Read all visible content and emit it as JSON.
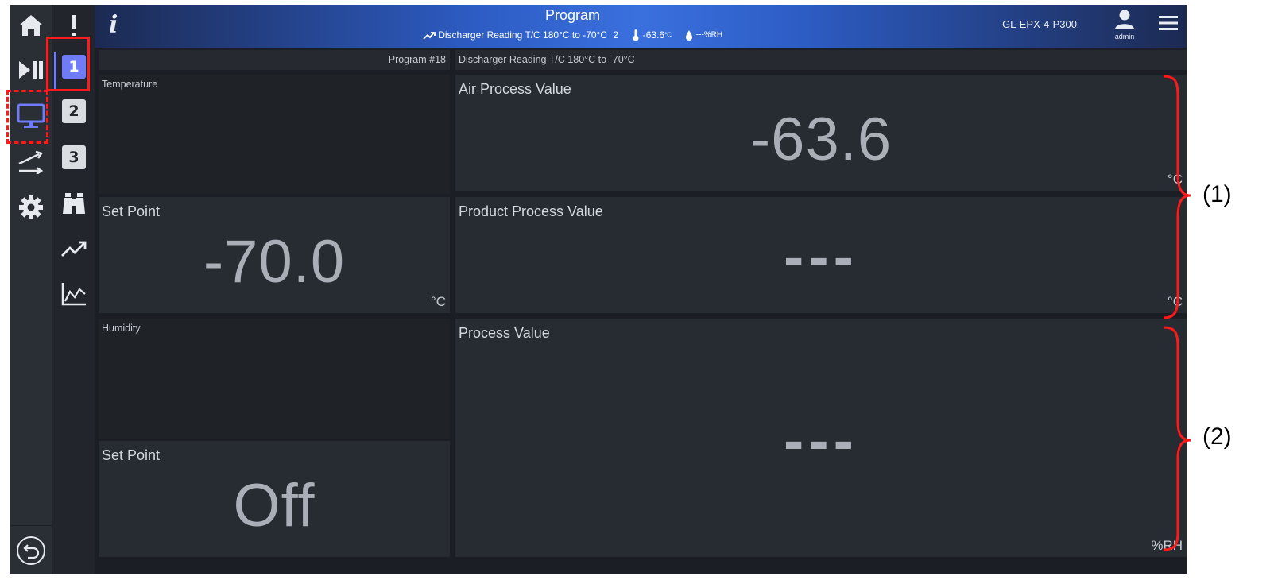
{
  "header": {
    "title": "Program",
    "subtitle_program": "Discharger Reading T/C 180°C to -70°C",
    "subtitle_step": "2",
    "subtitle_temp": "-63.6",
    "subtitle_temp_unit": "°C",
    "subtitle_humidity": "---%RH",
    "device_name": "GL-EPX-4-P300",
    "user_name": "admin"
  },
  "rail_primary": {
    "items": [
      "home-icon",
      "play-pause-icon",
      "monitor-icon",
      "transfer-icon",
      "gear-icon"
    ],
    "bottom": "back-icon"
  },
  "rail_secondary": {
    "items": [
      "alert-icon",
      "1",
      "2",
      "3",
      "binoculars-icon",
      "trend-icon",
      "chart-icon"
    ],
    "active": "1"
  },
  "program_bar": {
    "program_number": "Program #18",
    "program_name": "Discharger Reading T/C 180°C to -70°C"
  },
  "temperature": {
    "section_label": "Temperature",
    "setpoint_label": "Set Point",
    "setpoint_value": "-70.0",
    "setpoint_unit": "°C"
  },
  "air_process": {
    "label": "Air Process Value",
    "value": "-63.6",
    "unit": "°C"
  },
  "product_process": {
    "label": "Product Process Value",
    "value": "---",
    "unit": "°C"
  },
  "humidity": {
    "section_label": "Humidity",
    "setpoint_label": "Set Point",
    "setpoint_value": "Off"
  },
  "humidity_process": {
    "label": "Process Value",
    "value": "---",
    "unit": "%RH"
  },
  "annotations": {
    "label_1": "(1)",
    "label_2": "(2)"
  },
  "colors": {
    "accent": "#6f7bf7",
    "annotation": "#ff1a1a",
    "background": "#1b1f25",
    "panel": "#272b32"
  }
}
